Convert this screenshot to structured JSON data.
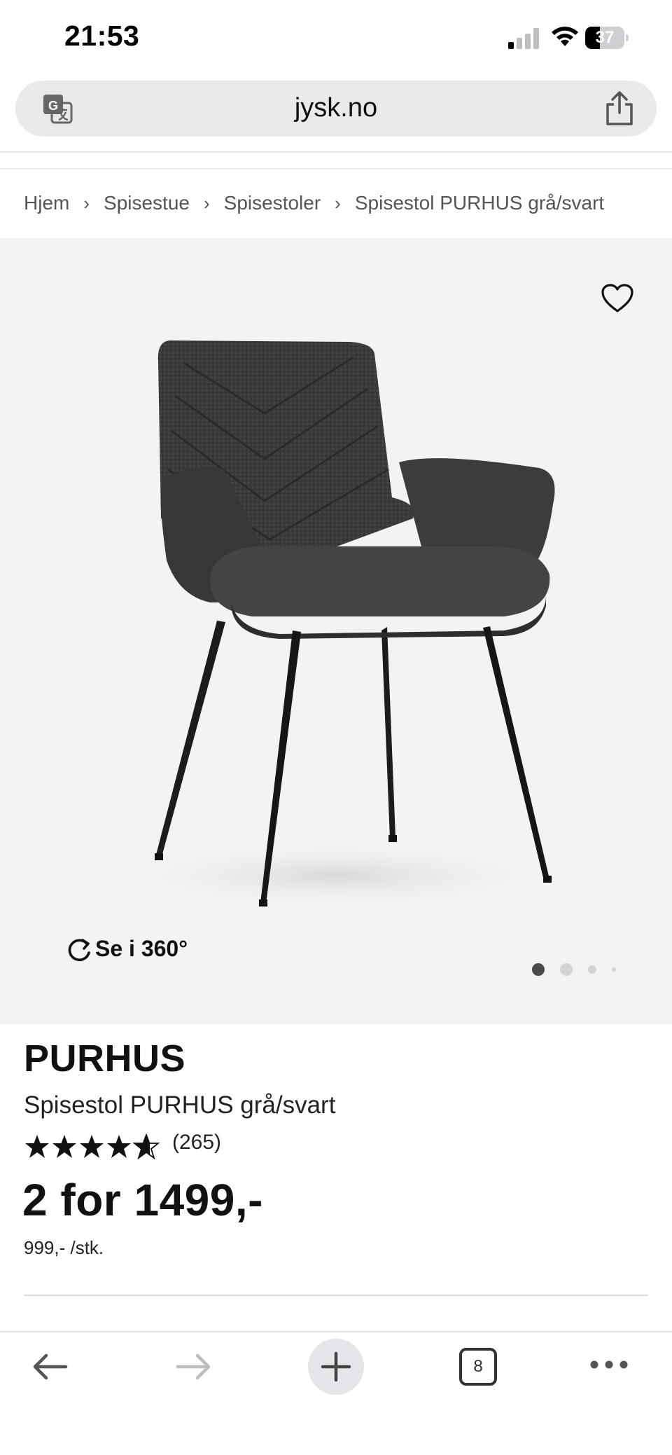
{
  "status_bar": {
    "time": "21:53",
    "battery_percent": "37",
    "battery_level": 0.37,
    "icons": [
      "signal-icon",
      "wifi-icon",
      "battery-icon"
    ]
  },
  "browser": {
    "url": "jysk.no",
    "icons": [
      "translate-icon",
      "share-icon"
    ]
  },
  "breadcrumb": [
    {
      "label": "Hjem"
    },
    {
      "label": "Spisestue"
    },
    {
      "label": "Spisestoler"
    },
    {
      "label": "Spisestol PURHUS grå/svart"
    }
  ],
  "gallery": {
    "view_360_label": "Se i 360°",
    "slide_count": 4,
    "active_slide": 1,
    "icons": [
      "heart-icon",
      "rotate-icon"
    ]
  },
  "product": {
    "brand": "PURHUS",
    "name": "Spisestol PURHUS grå/svart",
    "rating": 4.5,
    "rating_max": 5,
    "review_count": "(265)",
    "price": "2 for 1499,-",
    "unit_price": "999,- /stk."
  },
  "toolbar": {
    "tab_count": "8",
    "icons": [
      "back-arrow-icon",
      "forward-arrow-icon",
      "plus-icon",
      "tabs-icon",
      "more-icon"
    ]
  },
  "colors": {
    "gallery_bg": "#f3f3f3",
    "url_bar_bg": "#e9eaec",
    "chair_fabric": "#3b3b3d",
    "text": "#111111"
  }
}
